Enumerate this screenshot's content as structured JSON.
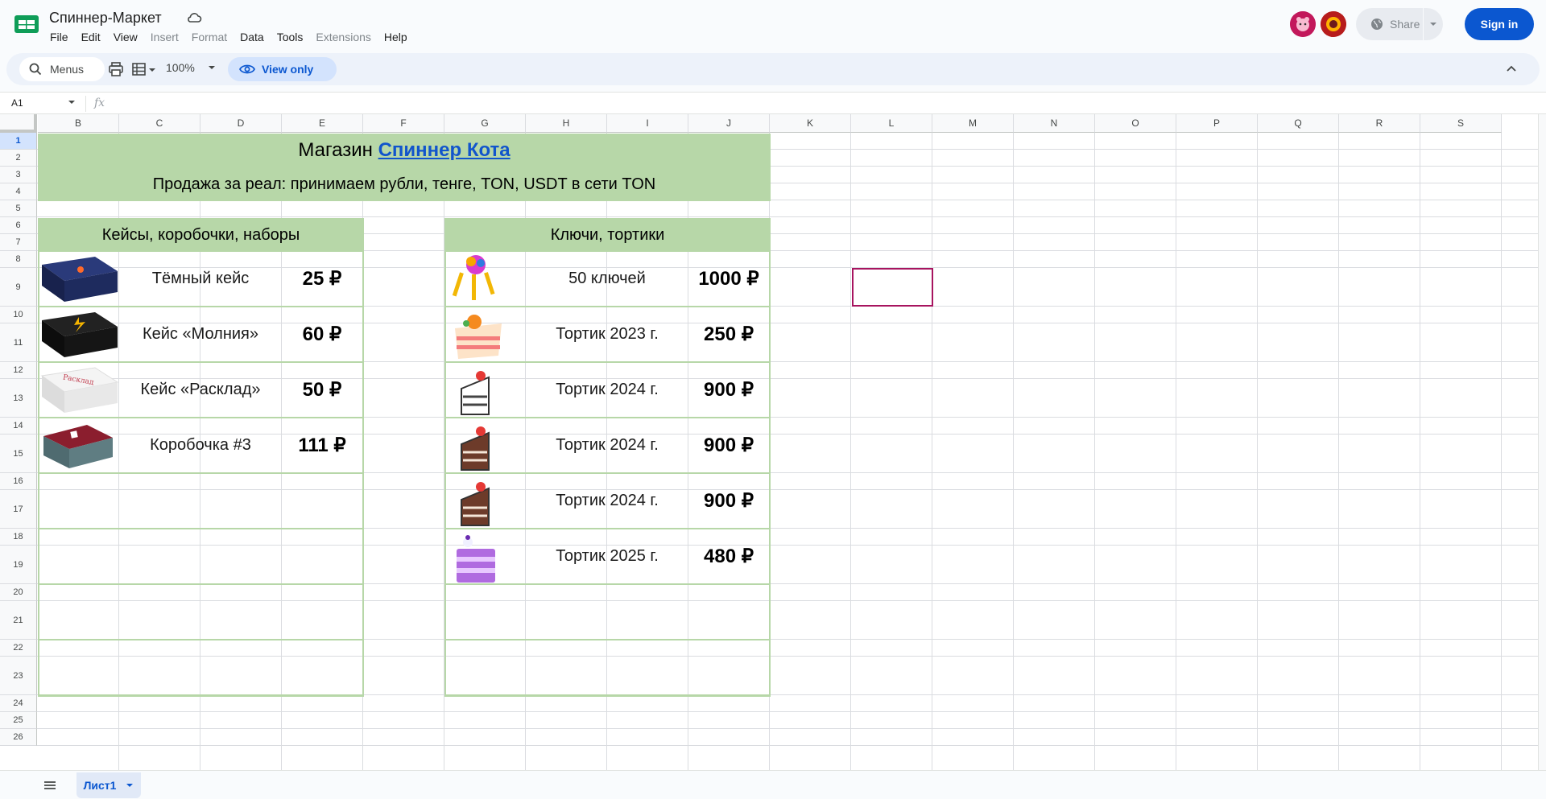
{
  "app": {
    "doc_title": "Спиннер-Маркет",
    "menus": [
      {
        "label": "File",
        "enabled": true
      },
      {
        "label": "Edit",
        "enabled": true
      },
      {
        "label": "View",
        "enabled": true
      },
      {
        "label": "Insert",
        "enabled": false
      },
      {
        "label": "Format",
        "enabled": false
      },
      {
        "label": "Data",
        "enabled": true
      },
      {
        "label": "Tools",
        "enabled": true
      },
      {
        "label": "Extensions",
        "enabled": false
      },
      {
        "label": "Help",
        "enabled": true
      }
    ],
    "share_label": "Share",
    "signin_label": "Sign in"
  },
  "toolbar": {
    "search_label": "Menus",
    "zoom": "100%",
    "view_only_label": "View only"
  },
  "formula_bar": {
    "cell_ref": "A1",
    "fx": "fx"
  },
  "grid": {
    "columns": [
      "B",
      "C",
      "D",
      "E",
      "F",
      "G",
      "H",
      "I",
      "J",
      "K",
      "L",
      "M",
      "N",
      "O",
      "P",
      "Q",
      "R",
      "S"
    ],
    "rows": [
      "1",
      "2",
      "3",
      "4",
      "5",
      "6",
      "7",
      "8",
      "9",
      "10",
      "11",
      "12",
      "13",
      "14",
      "15",
      "16",
      "17",
      "18",
      "19",
      "20",
      "21",
      "22",
      "23",
      "24",
      "25",
      "26"
    ],
    "selected_cell": "L9"
  },
  "content": {
    "title_prefix": "Магазин ",
    "title_link": "Спиннер Кота",
    "subtitle": "Продажа за реал: принимаем рубли, тенге, TON, USDT в сети TON",
    "left_table": {
      "header": "Кейсы, коробочки, наборы",
      "items": [
        {
          "name": "Тёмный кейс",
          "price": "25 ₽",
          "image": "dark-case-icon"
        },
        {
          "name": "Кейс «Молния»",
          "price": "60 ₽",
          "image": "lightning-case-icon"
        },
        {
          "name": "Кейс «Расклад»",
          "price": "50 ₽",
          "image": "layout-case-icon"
        },
        {
          "name": "Коробочка #3",
          "price": "111 ₽",
          "image": "box-3-icon"
        }
      ]
    },
    "right_table": {
      "header": "Ключи, тортики",
      "items": [
        {
          "name": "50 ключей",
          "price": "1000 ₽",
          "image": "keys-icon"
        },
        {
          "name": "Тортик 2023 г.",
          "price": "250 ₽",
          "image": "cake-2023-icon"
        },
        {
          "name": "Тортик 2024 г.",
          "price": "900 ₽",
          "image": "cake-2024-white-icon"
        },
        {
          "name": "Тортик 2024 г.",
          "price": "900 ₽",
          "image": "cake-2024-choc-icon"
        },
        {
          "name": "Тортик 2024 г.",
          "price": "900 ₽",
          "image": "cake-2024-choc-icon"
        },
        {
          "name": "Тортик 2025 г.",
          "price": "480 ₽",
          "image": "cake-2025-icon"
        }
      ]
    }
  },
  "sheets": {
    "active": "Лист1"
  },
  "colors": {
    "accent_green": "#b7d7a8",
    "link_blue": "#1155cc",
    "signin_blue": "#0b57d0",
    "selection": "#a7145f"
  }
}
